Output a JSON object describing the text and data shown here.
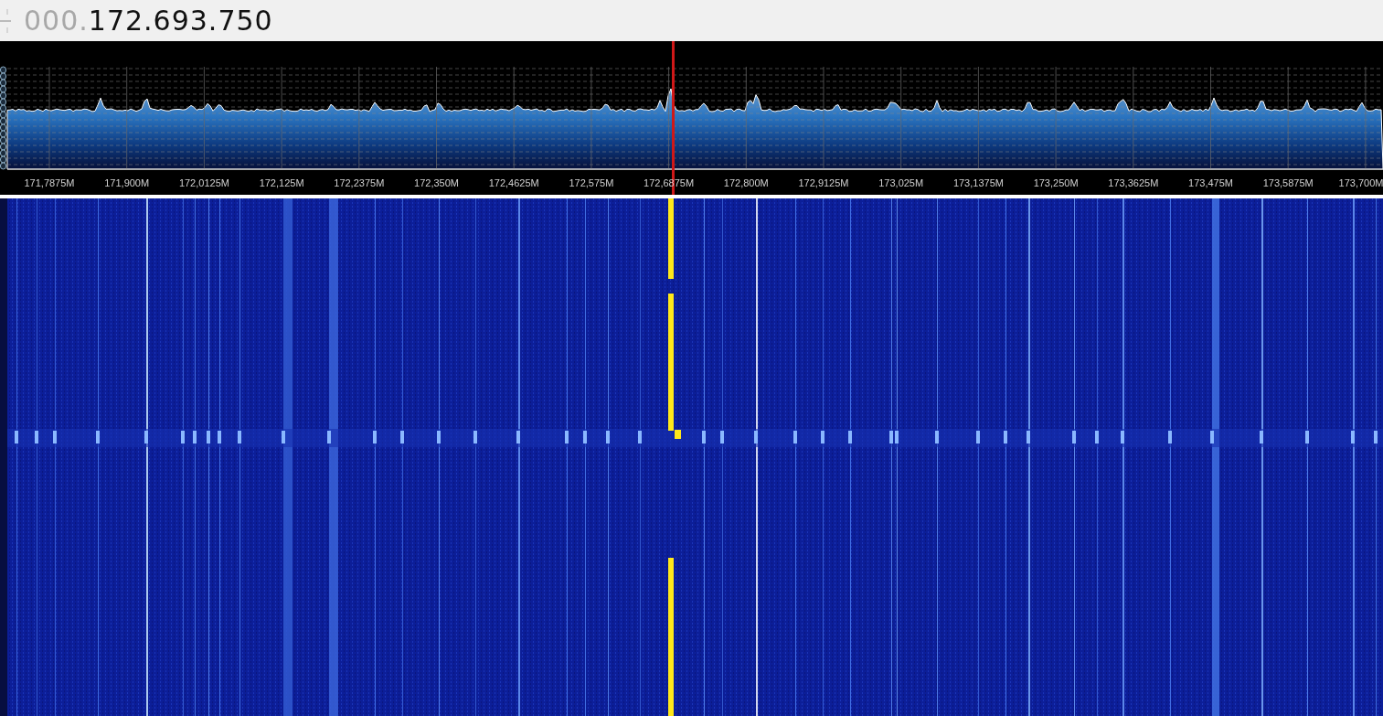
{
  "frequency_display": {
    "leading_digits": "000.",
    "value": "172.693.750"
  },
  "spectrum": {
    "axis_labels": [
      "171,7875M",
      "171,900M",
      "172,0125M",
      "172,125M",
      "172,2375M",
      "172,350M",
      "172,4625M",
      "172,575M",
      "172,6875M",
      "172,800M",
      "172,9125M",
      "173,025M",
      "173,1375M",
      "173,250M",
      "173,3625M",
      "173,475M",
      "173,5875M",
      "173,700M"
    ]
  }
}
